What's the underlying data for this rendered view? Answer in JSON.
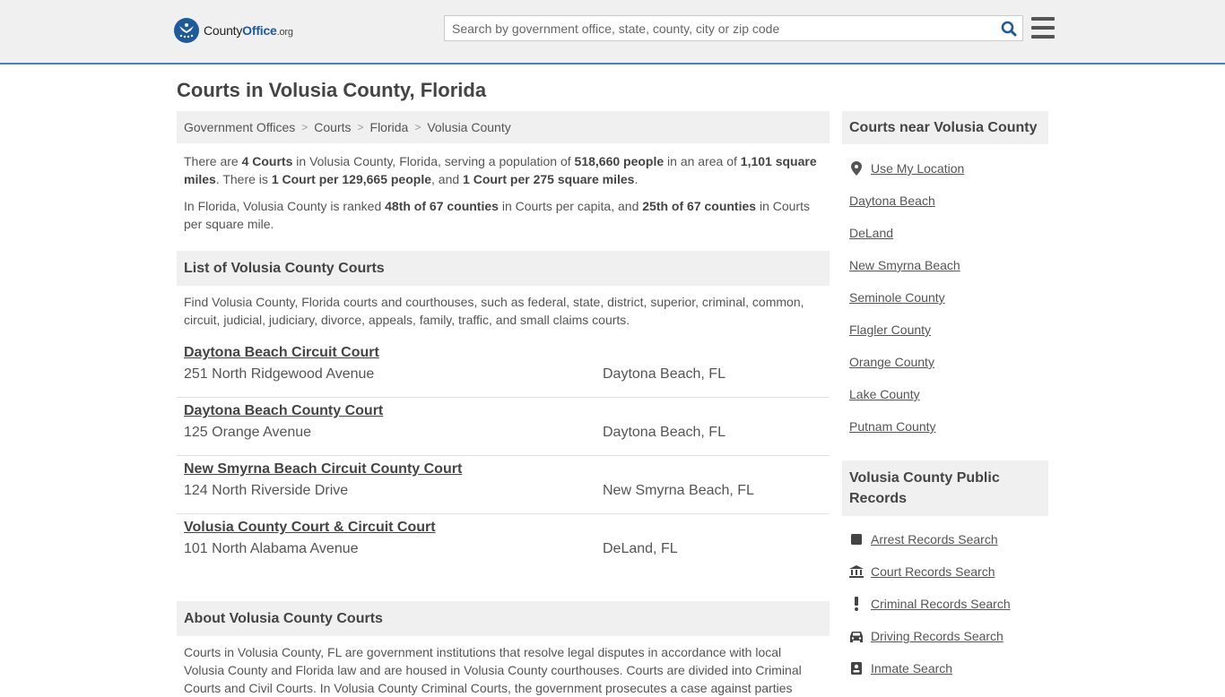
{
  "header": {
    "logo_text_a": "County",
    "logo_text_b": "Office",
    "logo_text_c": ".org",
    "search_placeholder": "Search by government office, state, county, city or zip code"
  },
  "page_title": "Courts in Volusia County, Florida",
  "breadcrumb": [
    "Government Offices",
    "Courts",
    "Florida",
    "Volusia County"
  ],
  "intro": {
    "p1": {
      "t1": "There are ",
      "b1": "4 Courts",
      "t2": " in Volusia County, Florida, serving a population of ",
      "b2": "518,660 people",
      "t3": " in an area of ",
      "b3": "1,101 square miles",
      "t4": ". There is ",
      "b4": "1 Court per 129,665 people",
      "t5": ", and ",
      "b5": "1 Court per 275 square miles",
      "t6": "."
    },
    "p2": {
      "t1": "In Florida, Volusia County is ranked ",
      "b1": "48th of 67 counties",
      "t2": " in Courts per capita, and ",
      "b2": "25th of 67 counties",
      "t3": " in Courts per square mile."
    }
  },
  "list_section": {
    "title": "List of Volusia County Courts",
    "description": "Find Volusia County, Florida courts and courthouses, such as federal, state, district, superior, criminal, common, circuit, judicial, judiciary, divorce, appeals, family, traffic, and small claims courts.",
    "courts": [
      {
        "name": "Daytona Beach Circuit Court",
        "address": "251 North Ridgewood Avenue",
        "city": "Daytona Beach, FL"
      },
      {
        "name": "Daytona Beach County Court",
        "address": "125 Orange Avenue",
        "city": "Daytona Beach, FL"
      },
      {
        "name": "New Smyrna Beach Circuit County Court",
        "address": "124 North Riverside Drive",
        "city": "New Smyrna Beach, FL"
      },
      {
        "name": "Volusia County Court & Circuit Court",
        "address": "101 North Alabama Avenue",
        "city": "DeLand, FL"
      }
    ]
  },
  "about_section": {
    "title": "About Volusia County Courts",
    "text": "Courts in Volusia County, FL are government institutions that resolve legal disputes in accordance with local Volusia County and Florida law and are housed in Volusia County courthouses. Courts are divided into Criminal Courts and Civil Courts. In Volusia County Criminal Courts, the government prosecutes a case against parties"
  },
  "sidebar": {
    "nearby_title": "Courts near Volusia County",
    "use_location": "Use My Location",
    "nearby": [
      "Daytona Beach",
      "DeLand",
      "New Smyrna Beach",
      "Seminole County",
      "Flagler County",
      "Orange County",
      "Lake County",
      "Putnam County"
    ],
    "records_title": "Volusia County Public Records",
    "records": [
      {
        "label": "Arrest Records Search",
        "icon": "square-icon"
      },
      {
        "label": "Court Records Search",
        "icon": "courthouse-icon"
      },
      {
        "label": "Criminal Records Search",
        "icon": "exclamation-icon"
      },
      {
        "label": "Driving Records Search",
        "icon": "car-icon"
      },
      {
        "label": "Inmate Search",
        "icon": "id-badge-icon"
      }
    ]
  },
  "colors": {
    "accent": "#3d86c6",
    "brand": "#1c5a9c"
  }
}
